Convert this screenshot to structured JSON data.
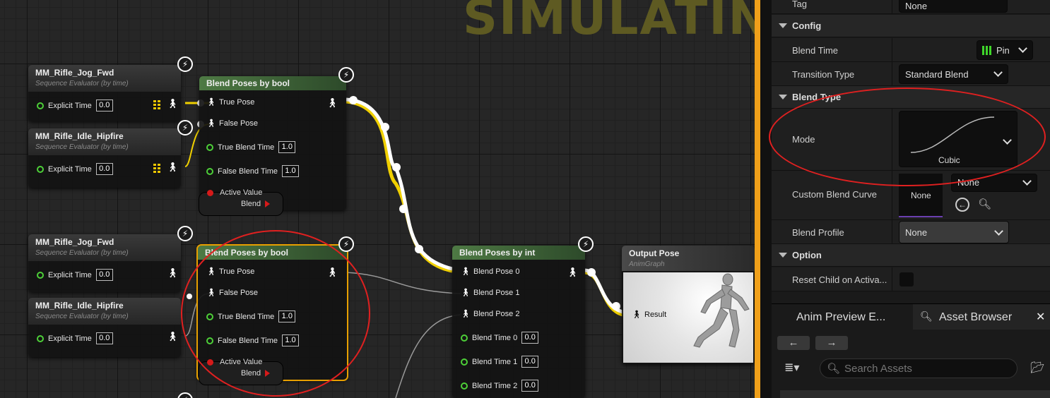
{
  "banner": "SIMULATING",
  "nodes": {
    "seq1": {
      "title": "MM_Rifle_Jog_Fwd",
      "subtitle": "Sequence Evaluator (by time)",
      "pin_label": "Explicit Time",
      "pin_value": "0.0"
    },
    "seq2": {
      "title": "MM_Rifle_Idle_Hipfire",
      "subtitle": "Sequence Evaluator (by time)",
      "pin_label": "Explicit Time",
      "pin_value": "0.0"
    },
    "seq3": {
      "title": "MM_Rifle_Jog_Fwd",
      "subtitle": "Sequence Evaluator (by time)",
      "pin_label": "Explicit Time",
      "pin_value": "0.0"
    },
    "seq4": {
      "title": "MM_Rifle_Idle_Hipfire",
      "subtitle": "Sequence Evaluator (by time)",
      "pin_label": "Explicit Time",
      "pin_value": "0.0"
    },
    "blend_bool_1": {
      "title": "Blend Poses by bool",
      "true_pose": "True Pose",
      "false_pose": "False Pose",
      "true_time_label": "True Blend Time",
      "true_time": "1.0",
      "false_time_label": "False Blend Time",
      "false_time": "1.0",
      "active_label": "Active Value",
      "blend_label": "Blend"
    },
    "blend_bool_2": {
      "title": "Blend Poses by bool",
      "true_pose": "True Pose",
      "false_pose": "False Pose",
      "true_time_label": "True Blend Time",
      "true_time": "1.0",
      "false_time_label": "False Blend Time",
      "false_time": "1.0",
      "active_label": "Active Value",
      "blend_label": "Blend"
    },
    "blend_int": {
      "title": "Blend Poses by int",
      "pose0": "Blend Pose 0",
      "pose1": "Blend Pose 1",
      "pose2": "Blend Pose 2",
      "time0_label": "Blend Time 0",
      "time0": "0.0",
      "time1_label": "Blend Time 1",
      "time1": "0.0",
      "time2_label": "Blend Time 2",
      "time2": "0.0"
    },
    "output": {
      "title": "Output Pose",
      "subtitle": "AnimGraph",
      "result": "Result"
    }
  },
  "details": {
    "tag_label": "Tag",
    "tag_value": "None",
    "config_section": "Config",
    "blend_time_label": "Blend Time",
    "blend_time_value": "Pin",
    "transition_type_label": "Transition Type",
    "transition_type_value": "Standard Blend",
    "blend_type_section": "Blend Type",
    "mode_label": "Mode",
    "mode_value": "Cubic",
    "custom_curve_label": "Custom Blend Curve",
    "custom_curve_thumb": "None",
    "custom_curve_value": "None",
    "blend_profile_label": "Blend Profile",
    "blend_profile_value": "None",
    "option_section": "Option",
    "reset_child_label": "Reset Child on Activa..."
  },
  "bottom": {
    "tab1": "Anim Preview E...",
    "tab2": "Asset Browser",
    "search_placeholder": "Search Assets"
  },
  "colors": {
    "accent_orange": "#f0a01a",
    "highlight_red": "#e02020",
    "pin_green": "#4dd038",
    "node_header_green": "#4e7a44"
  }
}
